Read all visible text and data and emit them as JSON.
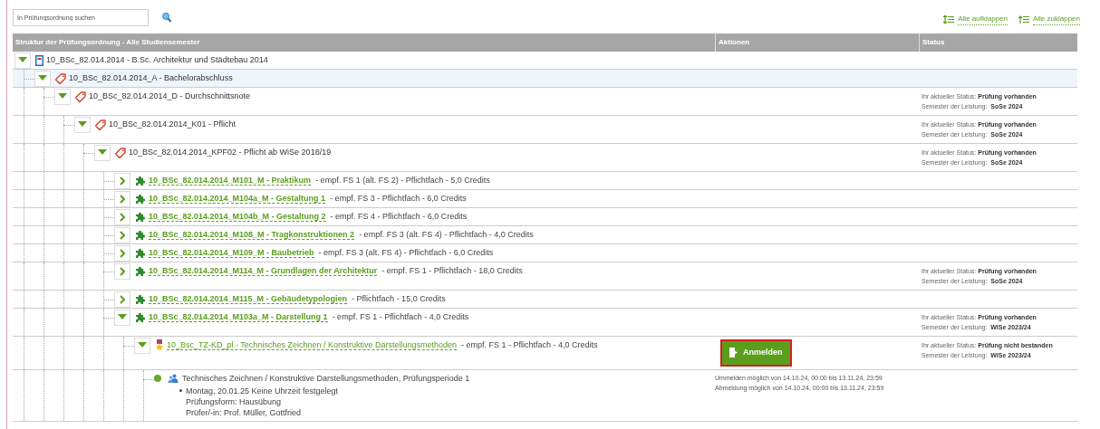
{
  "search": {
    "placeholder": "In Prüfungsordnung suchen"
  },
  "tree_actions": [
    {
      "kind": "expand",
      "label": "Alle aufklappen"
    },
    {
      "kind": "collapse",
      "label": "Alle zuklappen"
    }
  ],
  "table": {
    "columns": [
      "Struktur der Prüfungsordnung - Alle Studiensemester",
      "Aktionen",
      "Status"
    ],
    "rows": [
      {
        "kind": "program",
        "title": "10_BSc_82.014.2014 - B.Sc. Architektur und Städtebau 2014",
        "expanded": true,
        "selected": false,
        "children": [
          {
            "kind": "group",
            "title": "10_BSc_82.014.2014_A - Bachelorabschluss",
            "expanded": true,
            "selected": true,
            "children": [
              {
                "kind": "group",
                "title": "10_BSc_82.014.2014_D - Durchschnittsnote",
                "expanded": true,
                "selected": false,
                "status": {
                  "label": "Ihr aktueller Status:",
                  "value": "Prüfung vorhanden",
                  "semester_label": "Semester der Leistung:",
                  "semester": "SoSe 2024"
                },
                "children": [
                  {
                    "kind": "group",
                    "title": "10_BSc_82.014.2014_K01 - Pflicht",
                    "expanded": true,
                    "selected": false,
                    "status": {
                      "label": "Ihr aktueller Status:",
                      "value": "Prüfung vorhanden",
                      "semester_label": "Semester der Leistung:",
                      "semester": "SoSe 2024"
                    },
                    "children": [
                      {
                        "kind": "group",
                        "title": "10_BSc_82.014.2014_KPF02 - Pflicht ab WiSe 2018/19",
                        "expanded": true,
                        "selected": false,
                        "status": {
                          "label": "Ihr aktueller Status:",
                          "value": "Prüfung vorhanden",
                          "semester_label": "Semester der Leistung:",
                          "semester": "SoSe 2024"
                        },
                        "children": [
                          {
                            "kind": "module",
                            "title": "10_BSc_82.014.2014_M101_M - Praktikum",
                            "details": "- empf. FS 1 (alt. FS 2) - Pflichtfach - 5,0 Credits",
                            "expanded": false,
                            "selected": false
                          },
                          {
                            "kind": "module",
                            "title": "10_BSc_82.014.2014_M104a_M - Gestaltung 1",
                            "details": "- empf. FS 3 - Pflichtfach - 6,0 Credits",
                            "expanded": false,
                            "selected": false
                          },
                          {
                            "kind": "module",
                            "title": "10_BSc_82.014.2014_M104b_M - Gestaltung 2",
                            "details": "- empf. FS 4 - Pflichtfach - 6,0 Credits",
                            "expanded": false,
                            "selected": false
                          },
                          {
                            "kind": "module",
                            "title": "10_BSc_82.014.2014_M108_M - Tragkonstruktionen 2",
                            "details": "- empf. FS 3 (alt. FS 4) - Pflichtfach - 4,0 Credits",
                            "expanded": false,
                            "selected": false
                          },
                          {
                            "kind": "module",
                            "title": "10_BSc_82.014.2014_M109_M - Baubetrieb",
                            "details": "- empf. FS 3 (alt. FS 4) - Pflichtfach - 6,0 Credits",
                            "expanded": false,
                            "selected": false
                          },
                          {
                            "kind": "module",
                            "title": "10_BSc_82.014.2014_M114_M - Grundlagen der Architektur",
                            "details": "- empf. FS 1 - Pflichtfach - 18,0 Credits",
                            "expanded": false,
                            "selected": false,
                            "status": {
                              "label": "Ihr aktueller Status:",
                              "value": "Prüfung vorhanden",
                              "semester_label": "Semester der Leistung:",
                              "semester": "SoSe 2024"
                            }
                          },
                          {
                            "kind": "module",
                            "title": "10_BSc_82.014.2014_M115_M - Gebäudetypologien",
                            "details": "- Pflichtfach - 15,0 Credits",
                            "expanded": false,
                            "selected": false
                          },
                          {
                            "kind": "module",
                            "title": "10_BSc_82.014.2014_M103a_M - Darstellung 1",
                            "details": "- empf. FS 1 - Pflichtfach - 4,0 Credits",
                            "expanded": true,
                            "selected": false,
                            "status": {
                              "label": "Ihr aktueller Status:",
                              "value": "Prüfung vorhanden",
                              "semester_label": "Semester der Leistung:",
                              "semester": "WiSe 2023/24"
                            },
                            "children": [
                              {
                                "kind": "exam",
                                "title": "10_Bsc_TZ-KD_pl - Technisches Zeichnen / Konstruktive Darstellungsmethoden",
                                "details": "- empf. FS 1 - Pflichtfach - 4,0 Credits",
                                "expanded": true,
                                "selected": false,
                                "action": "Anmelden",
                                "status": {
                                  "label": "Ihr aktueller Status:",
                                  "value": "Prüfung nicht bestanden",
                                  "semester_label": "Semester der Leistung:",
                                  "semester": "WiSe 2023/24"
                                },
                                "children": [
                                  {
                                    "kind": "appointment",
                                    "title": "Technisches Zeichnen / Konstruktive Darstellungsmethoden, Prüfungsperiode 1",
                                    "date": "Montag, 20.01.25 Keine Uhrzeit festgelegt",
                                    "lines": [
                                      "Prüfungsform: Hausübung",
                                      "Prüfer/-in: Prof. Müller, Gottfried"
                                    ],
                                    "notes": [
                                      "Ummelden möglich von 14.10.24, 00:00 bis 13.11.24, 23:59",
                                      "Abmeldung möglich von 14.10.24, 00:00 bis 13.11.24, 23:59"
                                    ]
                                  }
                                ]
                              }
                            ]
                          }
                        ]
                      }
                    ]
                  }
                ]
              }
            ]
          }
        ]
      }
    ]
  }
}
